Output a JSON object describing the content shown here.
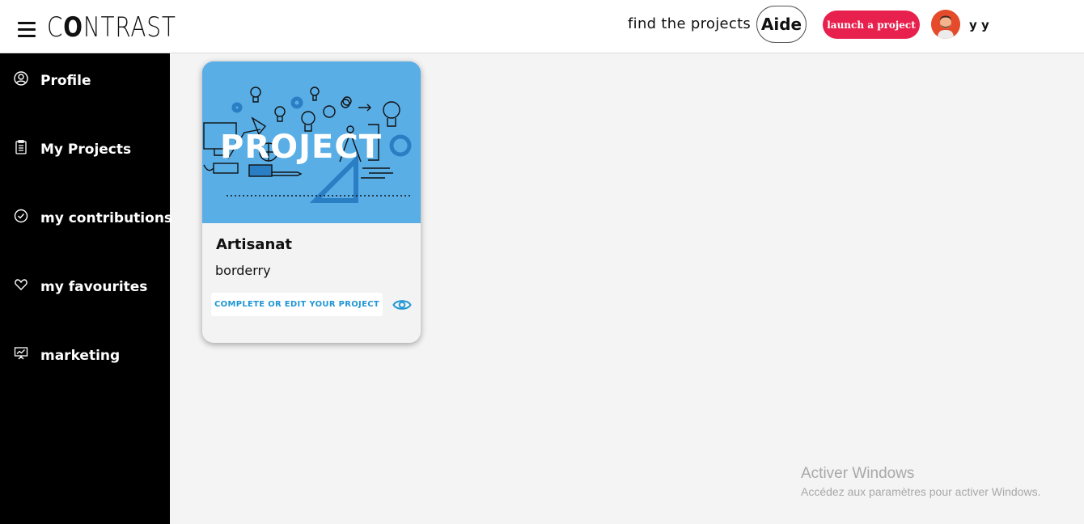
{
  "header": {
    "logo_prefix": "C",
    "logo_o": "O",
    "logo_suffix": "NTRAST",
    "find_projects": "find the projects",
    "aide": "Aide",
    "launch_project": "launch a project",
    "username": "y y"
  },
  "sidebar": {
    "items": [
      {
        "label": "Profile",
        "icon": "user-circle-icon"
      },
      {
        "label": "My Projects",
        "icon": "clipboard-icon"
      },
      {
        "label": "my contributions",
        "icon": "check-circle-icon"
      },
      {
        "label": "my favourites",
        "icon": "heart-icon"
      },
      {
        "label": "marketing",
        "icon": "presentation-chart-icon"
      }
    ]
  },
  "project_card": {
    "banner_text": "PROJECT",
    "title": "Artisanat",
    "subtitle": "borderry",
    "action_label": "COMPLETE OR EDIT YOUR PROJECT",
    "view_icon": "eye-icon"
  },
  "watermark": {
    "title": "Activer Windows",
    "subtitle": "Accédez aux paramètres pour activer Windows."
  },
  "colors": {
    "accent": "#e8204d",
    "link_blue": "#2196d4",
    "banner_blue": "#5aaee6",
    "sidebar_bg": "#000000"
  }
}
